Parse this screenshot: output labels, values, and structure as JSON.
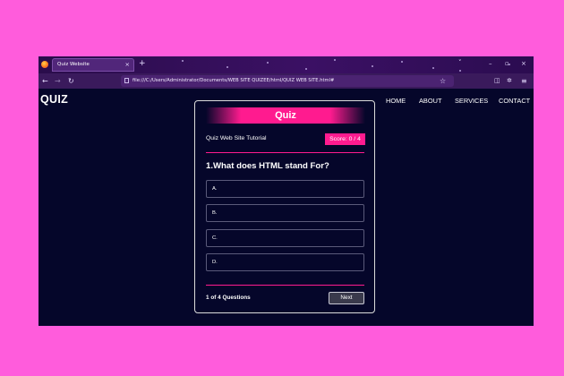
{
  "browser": {
    "tab_title": "Quiz Website",
    "tab_close": "×",
    "new_tab": "+",
    "tab_list": "˅",
    "url": "file:///C:/Users/Administrator/Documents/WEB SITE QUIZEE/html/QUIZ WEB SITE.html#",
    "back": "←",
    "forward": "→",
    "reload": "↻",
    "bookmark": "☆",
    "minimize": "–",
    "restore": "▫",
    "close": "×",
    "menu": "≡",
    "pocket": "◫",
    "extensions": "✲",
    "share": "↗"
  },
  "site": {
    "logo": "QUIZ",
    "nav": [
      "HOME",
      "ABOUT",
      "SERVICES",
      "CONTACT"
    ]
  },
  "quiz": {
    "title": "Quiz",
    "subtitle": "Quiz Web Site Tutorial",
    "score_label": "Score: 0 / 4",
    "question": "1.What does HTML stand For?",
    "options": [
      "A.",
      "B.",
      "C.",
      "D."
    ],
    "progress": "1 of 4 Questions",
    "next_label": "Next"
  },
  "colors": {
    "accent": "#ff1b8f",
    "page_bg": "#05062a",
    "outer_bg": "#ff5cdc"
  }
}
